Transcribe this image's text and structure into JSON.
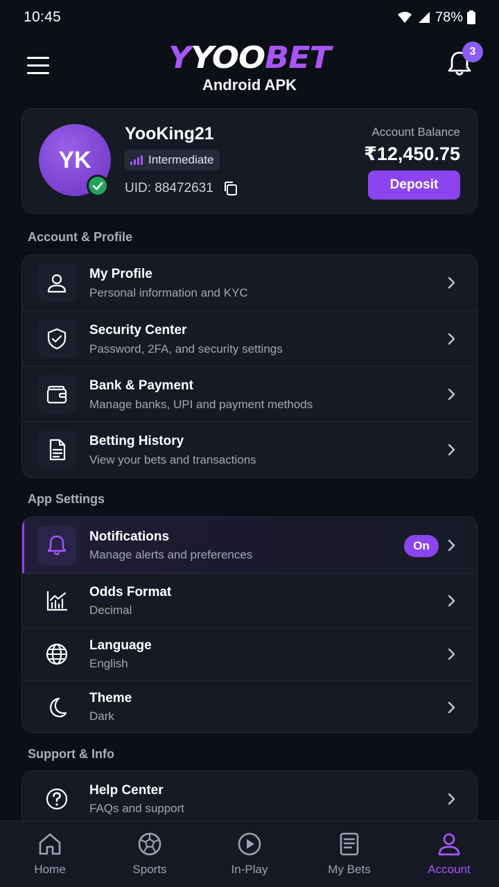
{
  "status": {
    "time": "10:45",
    "battery": "78%"
  },
  "header": {
    "logo_y": "Y",
    "logo_yoo": "YOO",
    "logo_bet": "BET",
    "subtitle": "Android APK",
    "notification_count": "3"
  },
  "profile": {
    "initials": "YK",
    "username": "YooKing21",
    "level": "Intermediate",
    "uid": "UID: 88472631",
    "balance_label": "Account Balance",
    "balance": "₹12,450.75",
    "deposit_label": "Deposit"
  },
  "account_section": {
    "title": "Account & Profile",
    "items": [
      {
        "title": "My Profile",
        "subtitle": "Personal information and KYC",
        "icon": "user-icon"
      },
      {
        "title": "Security Center",
        "subtitle": "Password, 2FA, and security settings",
        "icon": "shield-check-icon"
      },
      {
        "title": "Bank & Payment",
        "subtitle": "Manage banks, UPI and payment methods",
        "icon": "wallet-icon"
      },
      {
        "title": "Betting History",
        "subtitle": "View your bets and transactions",
        "icon": "document-icon"
      }
    ]
  },
  "app_settings": {
    "title": "App Settings",
    "items": [
      {
        "title": "Notifications",
        "subtitle": "Manage alerts and preferences",
        "icon": "bell-icon",
        "toggle": "On"
      },
      {
        "title": "Odds Format",
        "subtitle": "Decimal",
        "icon": "chart-icon"
      },
      {
        "title": "Language",
        "subtitle": "English",
        "icon": "globe-icon"
      },
      {
        "title": "Theme",
        "subtitle": "Dark",
        "icon": "moon-icon"
      }
    ]
  },
  "support_section": {
    "title": "Support & Info",
    "items": [
      {
        "title": "Help Center",
        "subtitle": "FAQs and support",
        "icon": "help-icon"
      }
    ]
  },
  "bottom_nav": {
    "items": [
      {
        "label": "Home",
        "icon": "home-icon"
      },
      {
        "label": "Sports",
        "icon": "soccer-ball-icon"
      },
      {
        "label": "In-Play",
        "icon": "play-circle-icon"
      },
      {
        "label": "My Bets",
        "icon": "betslip-icon"
      },
      {
        "label": "Account",
        "icon": "account-icon",
        "active": true
      }
    ]
  },
  "colors": {
    "accent": "#8b45ee",
    "background": "#0c0f16",
    "card": "#151a24",
    "success": "#22a35a"
  }
}
